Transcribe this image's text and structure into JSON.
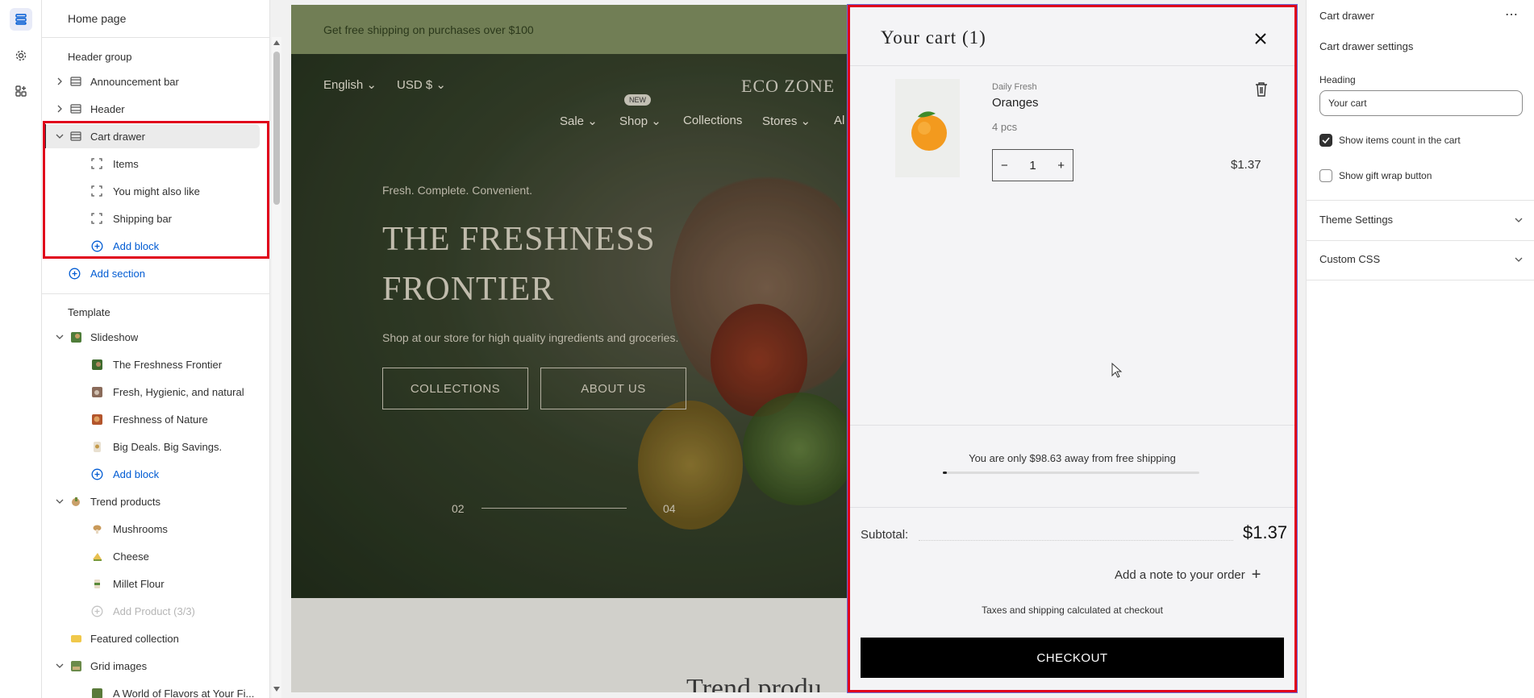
{
  "left_panel": {
    "title": "Home page",
    "header_group_label": "Header group",
    "header_items": [
      {
        "label": "Announcement bar"
      },
      {
        "label": "Header"
      },
      {
        "label": "Cart drawer"
      }
    ],
    "cart_drawer_blocks": [
      {
        "label": "Items"
      },
      {
        "label": "You might also like"
      },
      {
        "label": "Shipping bar"
      }
    ],
    "add_block_label": "Add block",
    "add_section_label": "Add section",
    "template_label": "Template",
    "slideshow": {
      "label": "Slideshow",
      "slides": [
        {
          "label": "The Freshness Frontier"
        },
        {
          "label": "Fresh, Hygienic, and natural"
        },
        {
          "label": "Freshness of Nature"
        },
        {
          "label": "Big Deals. Big Savings."
        }
      ],
      "add_block_label": "Add block"
    },
    "trend_products": {
      "label": "Trend products",
      "items": [
        {
          "label": "Mushrooms"
        },
        {
          "label": "Cheese"
        },
        {
          "label": "Millet Flour"
        }
      ],
      "add_product_label": "Add Product (3/3)"
    },
    "featured_collection_label": "Featured collection",
    "grid_images": {
      "label": "Grid images",
      "first_item": "A World of Flavors at Your Fi..."
    }
  },
  "preview": {
    "announcement": "Get free shipping on purchases over $100",
    "language": "English",
    "currency": "USD $",
    "logo": "ECO ZONE",
    "new_badge": "NEW",
    "menu": [
      "Sale",
      "Shop",
      "Collections",
      "Stores",
      "Al"
    ],
    "tagline": "Fresh. Complete. Convenient.",
    "title_line1": "THE FRESHNESS",
    "title_line2": "FRONTIER",
    "subtitle": "Shop at our store for high quality ingredients and groceries.",
    "button1": "COLLECTIONS",
    "button2": "ABOUT US",
    "slide_current": "02",
    "slide_total": "04",
    "trend_heading": "Trend produ"
  },
  "cart": {
    "title": "Your cart",
    "count": "(1)",
    "item": {
      "vendor": "Daily Fresh",
      "name": "Oranges",
      "variant": "4 pcs",
      "quantity": "1",
      "price": "$1.37"
    },
    "shipping_message": "You are only $98.63 away from free shipping",
    "shipping_progress": 0.0137,
    "subtotal_label": "Subtotal:",
    "subtotal_value": "$1.37",
    "note_label": "Add a note to your order",
    "tax_note": "Taxes and shipping calculated at checkout",
    "checkout_label": "CHECKOUT"
  },
  "right_panel": {
    "title": "Cart drawer",
    "section_title": "Cart drawer settings",
    "heading_label": "Heading",
    "heading_value": "Your cart",
    "show_count_label": "Show items count in the cart",
    "show_count_checked": true,
    "show_gift_label": "Show gift wrap button",
    "show_gift_checked": false,
    "theme_settings_label": "Theme Settings",
    "custom_css_label": "Custom CSS"
  },
  "colors": {
    "highlight": "#e0001b",
    "link_blue": "#005bd3",
    "announcement_bg": "#7b8a5c",
    "checkout_bg": "#000000"
  }
}
